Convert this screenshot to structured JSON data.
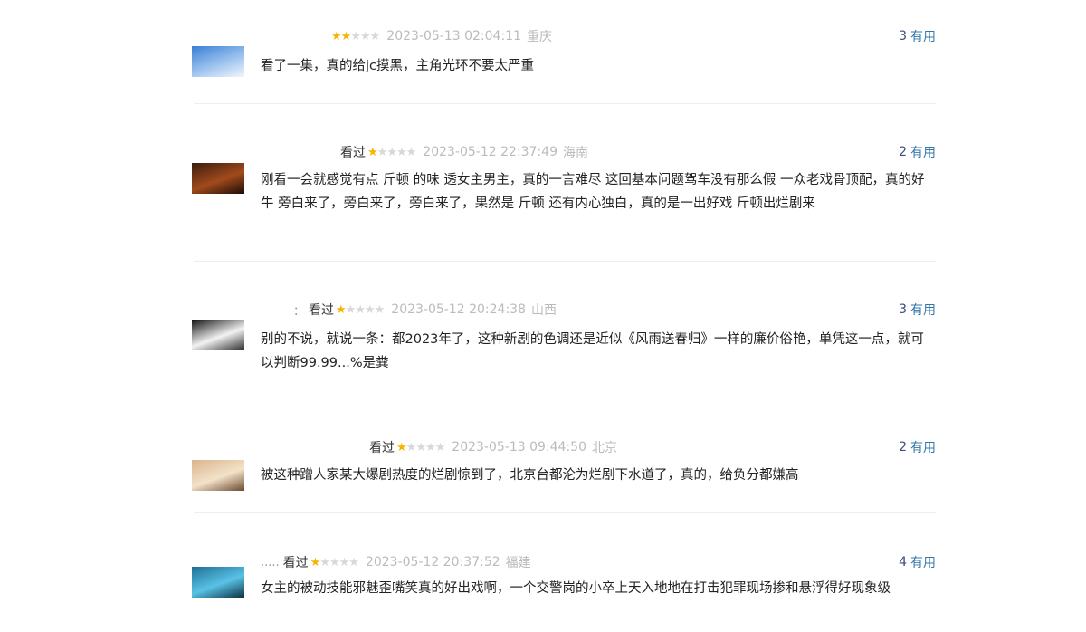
{
  "comments": [
    {
      "username": "",
      "status": "",
      "rating": 2,
      "time": "2023-05-13 02:04:11",
      "location": "重庆",
      "useful_count": "3",
      "useful_label": "有用",
      "text": "看了一集，真的给jc摸黑，主角光环不要太严重",
      "avatar_colors": [
        "#3b7fd4",
        "#9cc3ee",
        "#f2f6fb"
      ]
    },
    {
      "username": "",
      "status": "看过",
      "rating": 1,
      "time": "2023-05-12 22:37:49",
      "location": "海南",
      "useful_count": "2",
      "useful_label": "有用",
      "text": "刚看一会就感觉有点 斤顿 的味 透女主男主，真的一言难尽 这回基本问题驾车没有那么假 一众老戏骨顶配，真的好牛 旁白来了，旁白来了，旁白来了，果然是 斤顿 还有内心独白，真的是一出好戏 斤顿出烂剧来",
      "avatar_colors": [
        "#3a1d0e",
        "#a24a1c",
        "#1b0d06"
      ]
    },
    {
      "username": "：",
      "status": "看过",
      "rating": 1,
      "time": "2023-05-12 20:24:38",
      "location": "山西",
      "useful_count": "3",
      "useful_label": "有用",
      "text": "别的不说，就说一条：都2023年了，这种新剧的色调还是近似《风雨送春归》一样的廉价俗艳，单凭这一点，就可以判断99.99...%是粪",
      "avatar_colors": [
        "#111111",
        "#f3f3f3",
        "#2a2a2a"
      ]
    },
    {
      "username": "",
      "status": "看过",
      "rating": 1,
      "time": "2023-05-13 09:44:50",
      "location": "北京",
      "useful_count": "2",
      "useful_label": "有用",
      "text": "被这种蹭人家某大爆剧热度的烂剧惊到了，北京台都沦为烂剧下水道了，真的，给负分都嫌高",
      "avatar_colors": [
        "#d9b48c",
        "#f3e2c9",
        "#6b4a2f"
      ]
    },
    {
      "username": ".....",
      "status": "看过",
      "rating": 1,
      "time": "2023-05-12 20:37:52",
      "location": "福建",
      "useful_count": "4",
      "useful_label": "有用",
      "text": "女主的被动技能邪魅歪嘴笑真的好出戏啊，一个交警岗的小卒上天入地地在打击犯罪现场掺和悬浮得好现象级",
      "avatar_colors": [
        "#1f6f95",
        "#59c2e6",
        "#0d2f44"
      ]
    }
  ]
}
